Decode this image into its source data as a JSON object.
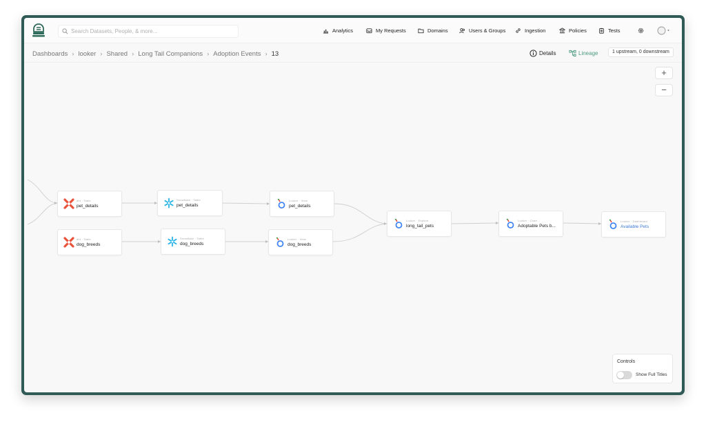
{
  "search": {
    "placeholder": "Search Datasets, People, & more..."
  },
  "nav": [
    {
      "label": "Analytics",
      "icon": "bar-chart-icon"
    },
    {
      "label": "My Requests",
      "icon": "inbox-icon"
    },
    {
      "label": "Domains",
      "icon": "folder-icon"
    },
    {
      "label": "Users & Groups",
      "icon": "users-icon"
    },
    {
      "label": "Ingestion",
      "icon": "link-icon"
    },
    {
      "label": "Policies",
      "icon": "bank-icon"
    },
    {
      "label": "Tests",
      "icon": "clipboard-icon"
    }
  ],
  "breadcrumb": [
    "Dashboards",
    "looker",
    "Shared",
    "Long Tail Companions",
    "Adoption Events",
    "13"
  ],
  "toolbar": {
    "details_label": "Details",
    "lineage_label": "Lineage",
    "lineage_summary": "1 upstream, 0 downstream"
  },
  "zoom": {
    "in_label": "+",
    "out_label": "−"
  },
  "nodes": [
    {
      "platform": "dbt",
      "type": "Table",
      "title": "pet_details",
      "icon": "dbt-icon"
    },
    {
      "platform": "dbt",
      "type": "Table",
      "title": "dog_breeds",
      "icon": "dbt-icon"
    },
    {
      "platform": "Snowflake",
      "type": "Table",
      "title": "pet_details",
      "icon": "snowflake-icon"
    },
    {
      "platform": "Snowflake",
      "type": "Table",
      "title": "dog_breeds",
      "icon": "snowflake-icon"
    },
    {
      "platform": "Looker",
      "type": "View",
      "title": "pet_details",
      "icon": "looker-icon"
    },
    {
      "platform": "Looker",
      "type": "View",
      "title": "dog_breeds",
      "icon": "looker-icon"
    },
    {
      "platform": "Looker",
      "type": "Explore",
      "title": "long_tail_pets",
      "icon": "looker-icon"
    },
    {
      "platform": "Looker",
      "type": "Chart",
      "title": "Adoptable Pets b...",
      "icon": "looker-icon"
    },
    {
      "platform": "Looker",
      "type": "Dashboard",
      "title": "Available Pets",
      "icon": "looker-icon"
    }
  ],
  "controls": {
    "title": "Controls",
    "toggle_label": "Show Full Titles",
    "toggle_on": false
  },
  "colors": {
    "accent": "#4c9a7e",
    "frame": "#2f5a55",
    "link": "#3d7ad6",
    "dbt": "#e8543a",
    "snowflake": "#29b5e8",
    "looker": "#4285f4"
  }
}
